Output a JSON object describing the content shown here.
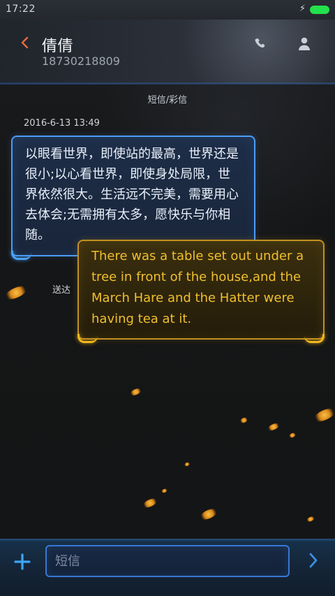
{
  "status_bar": {
    "time": "17:22",
    "battery_color": "#23e14c"
  },
  "header": {
    "contact_name": "倩倩",
    "contact_number": "18730218809",
    "icons": [
      "back-icon",
      "phone-icon",
      "person-icon"
    ]
  },
  "conversation": {
    "channel_label": "短信/彩信",
    "timestamp": "2016-6-13 13:49",
    "incoming_message": "以眼看世界，即使站的最高，世界还是很小;以心看世界，即使身处局限，世界依然很大。生活远不完美，需要用心去体会;无需拥有太多，愿快乐与你相随。",
    "outgoing_message": "There was a table set out under a tree in front of the house,and the March Hare and the Hatter were having tea at it.",
    "outgoing_status": "送达"
  },
  "composer": {
    "placeholder": "短信",
    "icons": [
      "add-icon",
      "send-icon"
    ],
    "accent_color": "#3877d5"
  },
  "theme": {
    "incoming_bubble_border": "#4a9df6",
    "outgoing_bubble_border": "#c09020",
    "outgoing_text": "#f0bf2f",
    "spark_color": "#ffb52a"
  }
}
